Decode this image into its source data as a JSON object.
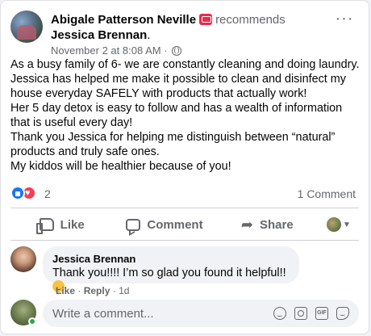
{
  "post": {
    "author": "Abigale Patterson Neville",
    "verb": "recommends",
    "target_name": "Jessica Brennan",
    "target_suffix": ".",
    "timestamp": "November 2 at 8:08 AM",
    "separator": "·",
    "paragraphs": [
      "As a busy family of 6- we are constantly cleaning and doing laundry. Jessica has helped me make it possible to clean and disinfect my house everyday SAFELY with products that actually work!",
      "Her 5 day detox is easy to follow and has a wealth of information that is useful every day!",
      "Thank you Jessica for helping me distinguish between “natural” products and truly safe ones.",
      "My kiddos will be healthier because of you!"
    ],
    "reaction_count": "2",
    "comment_count": "1 Comment"
  },
  "actions": {
    "like": "Like",
    "comment": "Comment",
    "share": "Share"
  },
  "comment": {
    "author": "Jessica Brennan",
    "text": "Thank you!!!! I’m so glad you found it helpful!!",
    "like": "Like",
    "dot": "·",
    "reply": "Reply",
    "age": "· 1d"
  },
  "composer": {
    "placeholder": "Write a comment..."
  },
  "icons": [
    "recommend-icon",
    "globe-icon",
    "more-icon",
    "like-reaction-icon",
    "love-reaction-icon",
    "like-icon",
    "comment-icon",
    "share-icon",
    "caret-icon",
    "smile-icon",
    "camera-icon",
    "gif-icon",
    "sticker-icon"
  ],
  "colors": {
    "brand": "#1877f2",
    "love": "#f33e58",
    "muted": "#65676b",
    "online": "#31a24c"
  }
}
